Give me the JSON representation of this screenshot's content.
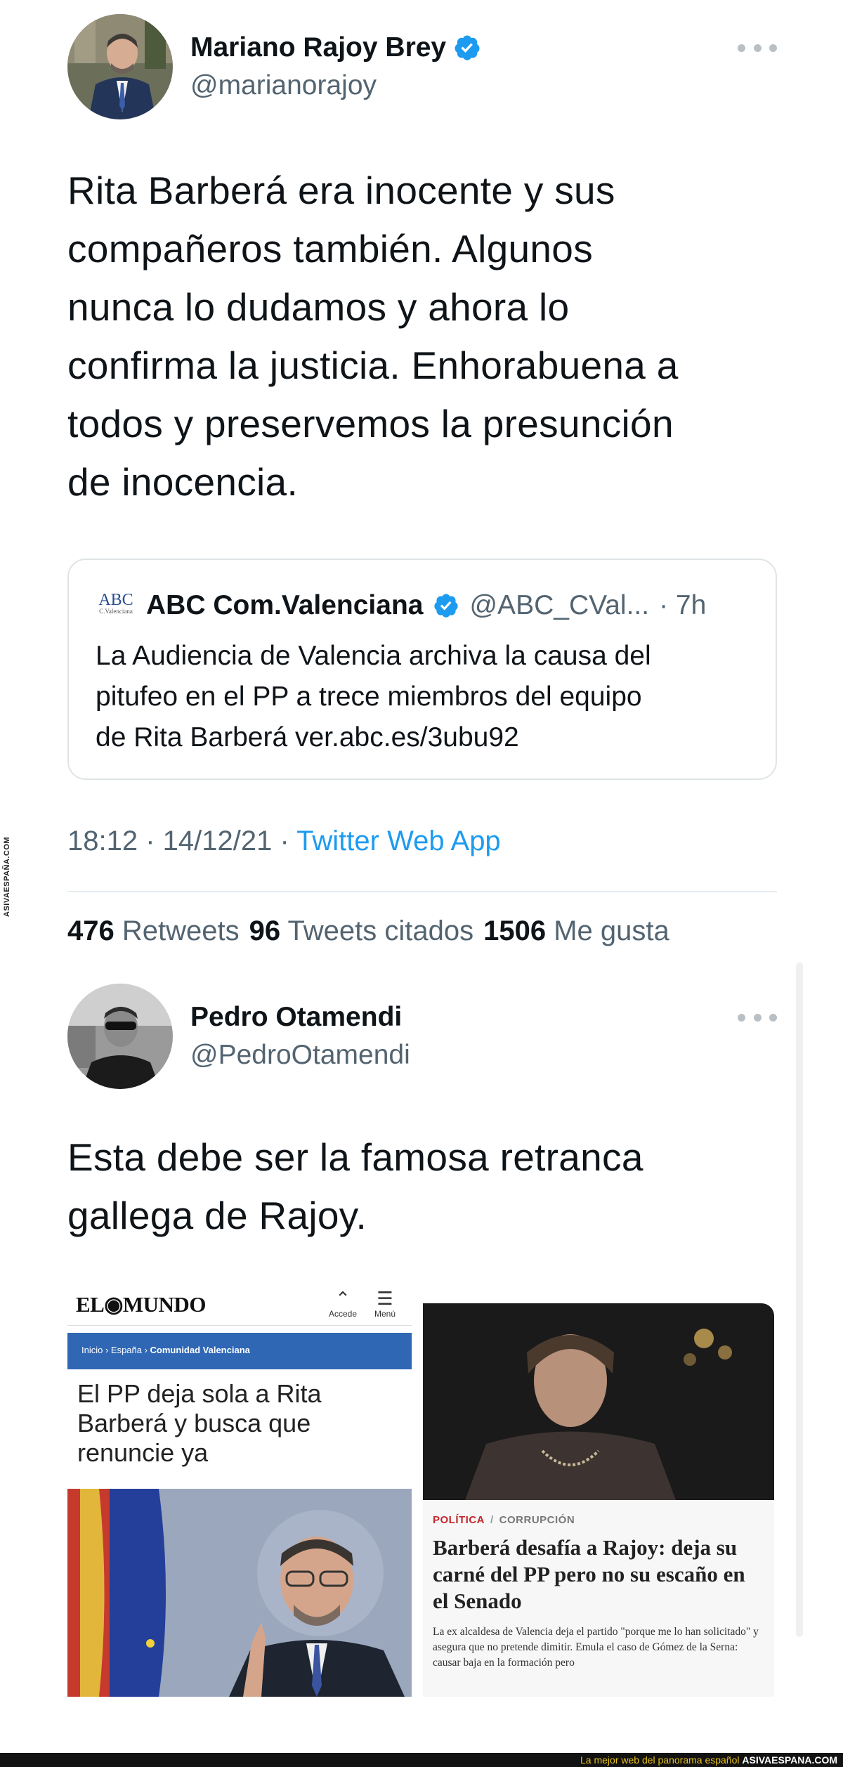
{
  "watermark": {
    "side_text": "ASIVAESPAÑA.COM",
    "bottom_text": "La mejor web del panorama español",
    "bottom_brand": "ASIVAESPANA.COM"
  },
  "tweet1": {
    "author_name": "Mariano Rajoy Brey",
    "handle": "@marianorajoy",
    "text_lines": [
      "Rita Barberá era inocente y sus",
      "compañeros también. Algunos",
      "nunca lo dudamos y ahora lo",
      "confirma la justicia. Enhorabuena a",
      "todos y preservemos la presunción",
      "de inocencia."
    ],
    "quote": {
      "logo_text": "ABC",
      "logo_sub": "C.Valenciana",
      "name": "ABC Com.Valenciana",
      "handle": "@ABC_CVal...",
      "time": "· 7h",
      "text_lines": [
        "La Audiencia de Valencia archiva la causa del",
        "pitufeo en el PP a trece miembros del equipo",
        "de Rita Barberá ver.abc.es/3ubu92"
      ]
    },
    "timestamp": "18:12 · 14/12/21 · ",
    "source": "Twitter Web App",
    "stats": {
      "retweets_count": "476",
      "retweets_label": "Retweets",
      "quotes_count": "96",
      "quotes_label": "Tweets citados",
      "likes_count": "1506",
      "likes_label": "Me gusta"
    }
  },
  "tweet2": {
    "author_name": "Pedro Otamendi",
    "handle": "@PedroOtamendi",
    "text_lines": [
      "Esta debe ser la famosa retranca",
      "gallega de Rajoy."
    ],
    "media_left": {
      "logo": "EL◉MUNDO",
      "access_label": "Accede",
      "menu_label": "Menú",
      "breadcrumb_start": "Inicio › España › ",
      "breadcrumb_end": "Comunidad Valenciana",
      "headline": "El PP deja sola a Rita Barberá y busca que renuncie ya"
    },
    "media_right": {
      "category": "POLÍTICA",
      "separator": "/",
      "subcategory": "CORRUPCIÓN",
      "title": "Barberá desafía a Rajoy: deja su carné del PP pero no su escaño en el Senado",
      "lede": "La ex alcaldesa de Valencia deja el partido \"porque me lo han solicitado\" y asegura que no pretende dimitir. Emula el caso de Gómez de la Serna: causar baja en la formación pero"
    }
  },
  "colors": {
    "verified": "#1d9bf0",
    "link": "#1d9bf0",
    "secondary_text": "#536471",
    "elmundo_bar": "#2f67b5",
    "category_red": "#c1272d"
  },
  "icons": [
    "verified-badge-icon",
    "more-icon",
    "search-access-icon",
    "menu-icon"
  ]
}
